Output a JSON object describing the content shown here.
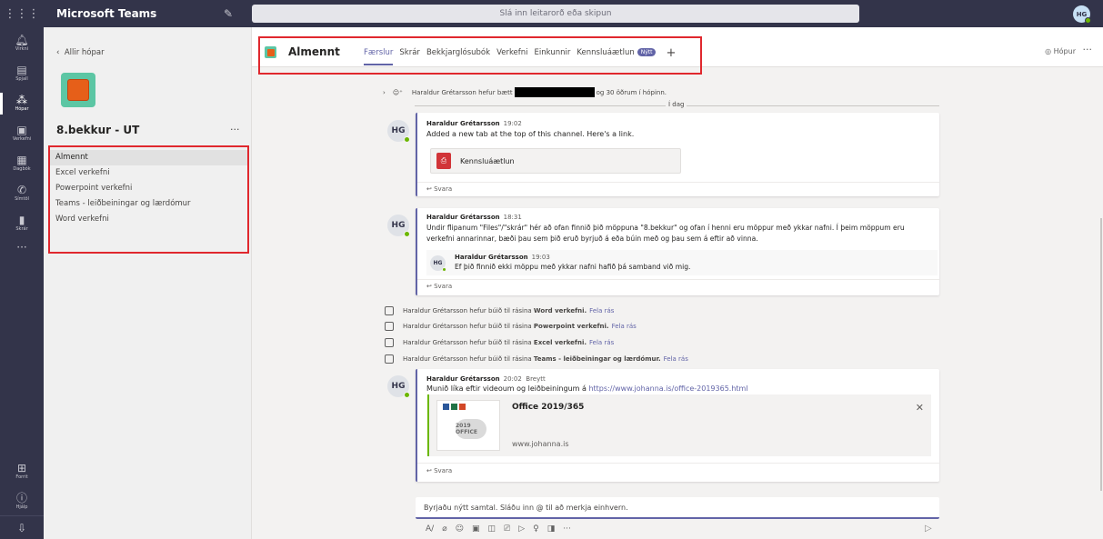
{
  "app": {
    "name": "Microsoft Teams",
    "search_placeholder": "Slá inn leitarorð eða skipun",
    "user_initials": "HG"
  },
  "rail": {
    "items": [
      {
        "label": "Virkni",
        "icon": "bell-icon",
        "glyph": "🔔︎"
      },
      {
        "label": "Spjall",
        "icon": "chat-icon",
        "glyph": "▤"
      },
      {
        "label": "Hópar",
        "icon": "teams-icon",
        "glyph": "⁂"
      },
      {
        "label": "Verkefni",
        "icon": "assignments-icon",
        "glyph": "▣"
      },
      {
        "label": "Dagbók",
        "icon": "calendar-icon",
        "glyph": "▦"
      },
      {
        "label": "Símtöl",
        "icon": "phone-icon",
        "glyph": "✆"
      },
      {
        "label": "Skrár",
        "icon": "files-icon",
        "glyph": "▮"
      }
    ],
    "more": "···",
    "bottom": [
      {
        "label": "Forrit",
        "icon": "apps-icon",
        "glyph": "⊞"
      },
      {
        "label": "Hjálp",
        "icon": "help-icon",
        "glyph": "ⓘ"
      }
    ]
  },
  "team_panel": {
    "back_label": "Allir hópar",
    "team_name": "8.bekkur - UT",
    "more": "···",
    "channels": [
      "Almennt",
      "Excel verkefni",
      "Powerpoint verkefni",
      "Teams - leiðbeiningar og lærdómur",
      "Word verkefni"
    ]
  },
  "channel_header": {
    "name": "Almennt",
    "tabs": [
      "Færslur",
      "Skrár",
      "Bekkjarglósubók",
      "Verkefni",
      "Einkunnir",
      "Kennsluáætlun"
    ],
    "new_badge": "Nýtt",
    "add": "+",
    "team_button": "Hópur",
    "more": "···"
  },
  "feed": {
    "added_line": {
      "author": "Haraldur Grétarsson hefur bætt",
      "rest": "og 30 öðrum í hópinn."
    },
    "day_label": "Í dag",
    "messages": [
      {
        "author": "Haraldur Grétarsson",
        "time": "19:02",
        "body": "Added a new tab at the top of this channel. Here's a link.",
        "tab_card": "Kennsluáætlun",
        "reply": "Svara"
      },
      {
        "author": "Haraldur Grétarsson",
        "time": "18:31",
        "body1": "Undir flipanum \"Files\"/\"skrár\" hér að ofan finnið þið möppuna \"8.bekkur\" og ofan í henni eru möppur með ykkar nafni. Í þeim möppum eru",
        "body2": "verkefni annarinnar, bæði þau sem þið eruð byrjuð á eða búin með og þau sem á eftir að vinna.",
        "reply_author": "Haraldur Grétarsson",
        "reply_time": "19:03",
        "reply_body": "Ef þið finnið ekki möppu með ykkar nafni hafið þá samband við mig.",
        "reply": "Svara"
      },
      {
        "author": "Haraldur Grétarsson",
        "time": "20:02",
        "edited": "Breytt",
        "body": "Munið líka eftir videoum og leiðbeiningum á",
        "link": "https://www.johanna.is/office-2019365.html",
        "preview_title": "Office 2019/365",
        "preview_domain": "www.johanna.is",
        "preview_logo": "2019 OFFICE",
        "reply": "Svara"
      }
    ],
    "system_lines": [
      {
        "prefix": "Haraldur Grétarsson hefur búið til rásina",
        "channel": "Word verkefni.",
        "action": "Fela rás"
      },
      {
        "prefix": "Haraldur Grétarsson hefur búið til rásina",
        "channel": "Powerpoint verkefni.",
        "action": "Fela rás"
      },
      {
        "prefix": "Haraldur Grétarsson hefur búið til rásina",
        "channel": "Excel verkefni.",
        "action": "Fela rás"
      },
      {
        "prefix": "Haraldur Grétarsson hefur búið til rásina",
        "channel": "Teams - leiðbeiningar og lærdómur.",
        "action": "Fela rás"
      }
    ],
    "compose_placeholder": "Byrjaðu nýtt samtal. Sláðu inn @ til að merkja einhvern."
  },
  "colors": {
    "accent": "#6264a7",
    "rail": "#33344a",
    "highlight_box": "#e0282e",
    "presence": "#6bb700"
  }
}
